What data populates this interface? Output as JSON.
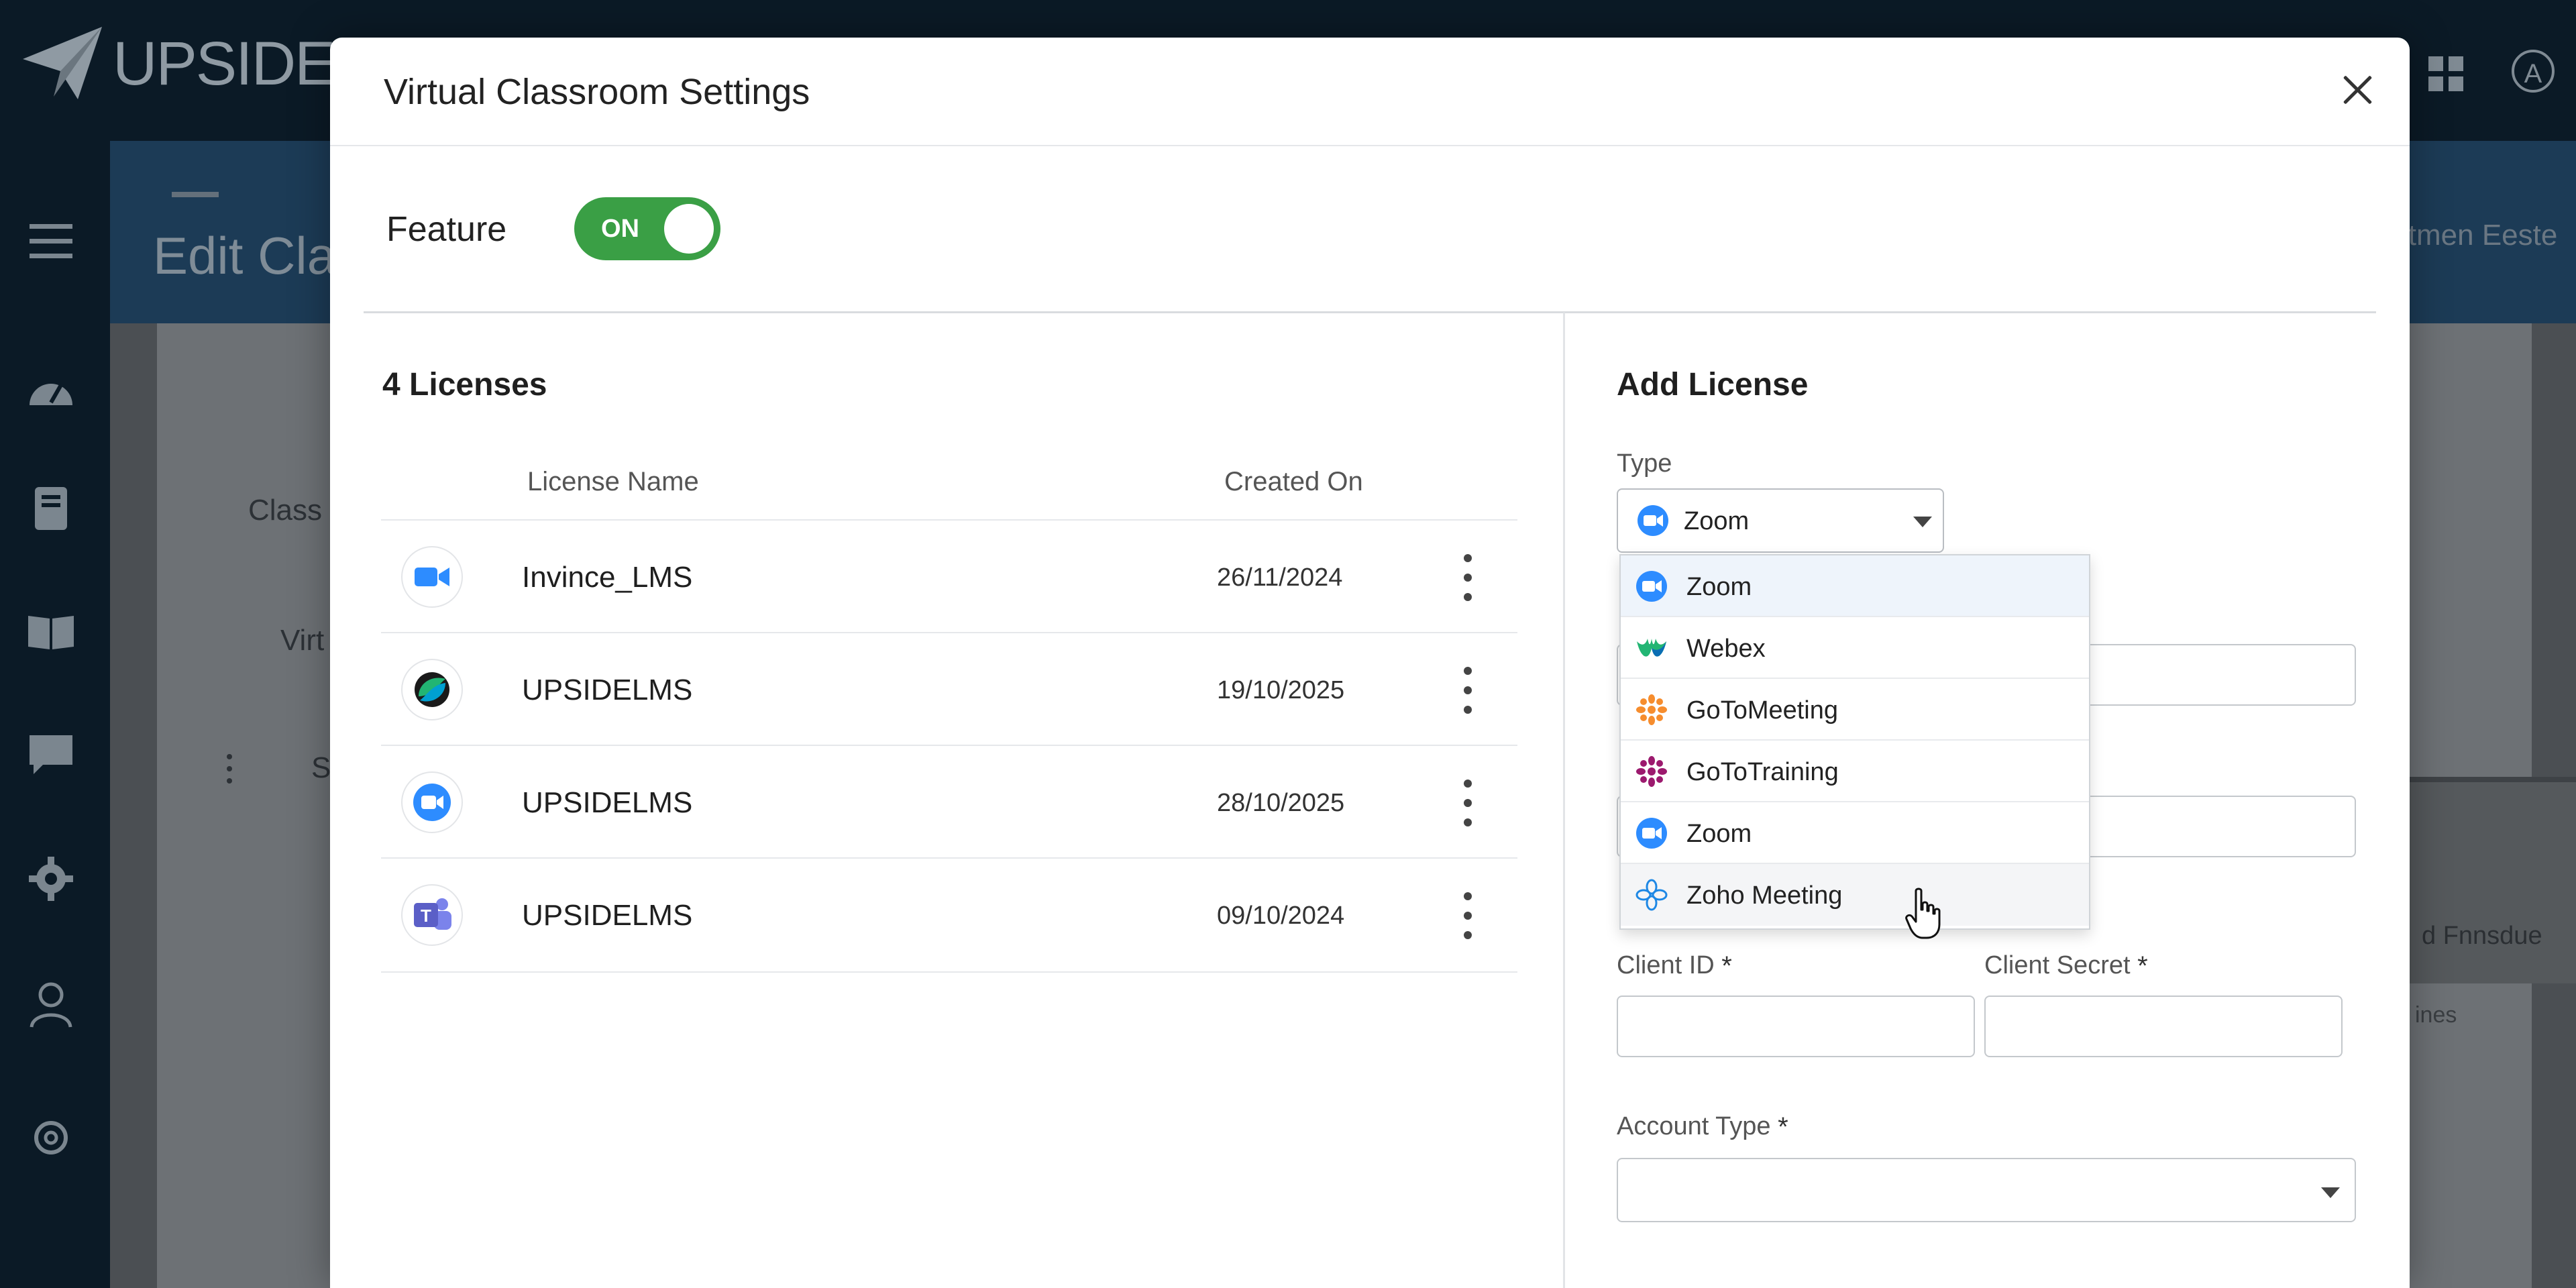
{
  "app": {
    "logo_text": "UPSIDEL",
    "page_title": "Edit Cla",
    "header_right_text": "itmen Eeste",
    "avatar_letter": "A"
  },
  "background": {
    "labels": [
      "Class",
      "Virt",
      "S"
    ],
    "right_panel_text": "d Fnnsdue",
    "right_panel_text2": "ines"
  },
  "modal": {
    "title": "Virtual Classroom Settings",
    "feature_label": "Feature",
    "feature_toggle": "ON",
    "feature_on": true
  },
  "licenses": {
    "count_label": "4 Licenses",
    "columns": {
      "name": "License Name",
      "created": "Created On"
    },
    "rows": [
      {
        "name": "Invince_LMS",
        "created_on": "26/11/2024",
        "icon": "zoom-icon"
      },
      {
        "name": "UPSIDELMS",
        "created_on": "19/10/2025",
        "icon": "webex-icon"
      },
      {
        "name": "UPSIDELMS",
        "created_on": "28/10/2025",
        "icon": "zoom-icon"
      },
      {
        "name": "UPSIDELMS",
        "created_on": "09/10/2024",
        "icon": "teams-icon"
      }
    ]
  },
  "add_license": {
    "title": "Add License",
    "type_label": "Type",
    "type_value": "Zoom",
    "client_id_label": "Client ID",
    "client_secret_label": "Client Secret",
    "account_type_label": "Account Type",
    "required_mark": "*",
    "type_options": [
      {
        "label": "Zoom",
        "icon": "zoom-icon",
        "state": "selected"
      },
      {
        "label": "Webex",
        "icon": "webex-icon",
        "state": ""
      },
      {
        "label": "GoToMeeting",
        "icon": "gotomeeting-icon",
        "state": ""
      },
      {
        "label": "GoToTraining",
        "icon": "gototraining-icon",
        "state": ""
      },
      {
        "label": "Zoom",
        "icon": "zoom-icon",
        "state": ""
      },
      {
        "label": "Zoho Meeting",
        "icon": "zoho-meeting-icon",
        "state": "hover"
      }
    ]
  },
  "colors": {
    "toggle_on": "#3a9f45",
    "zoom_blue": "#2d8cff",
    "gotomeeting_orange": "#f68d2e",
    "gototraining_magenta": "#9c1a6e",
    "teams_purple": "#5b5fc7",
    "zoho_blue": "#1e88e5"
  }
}
